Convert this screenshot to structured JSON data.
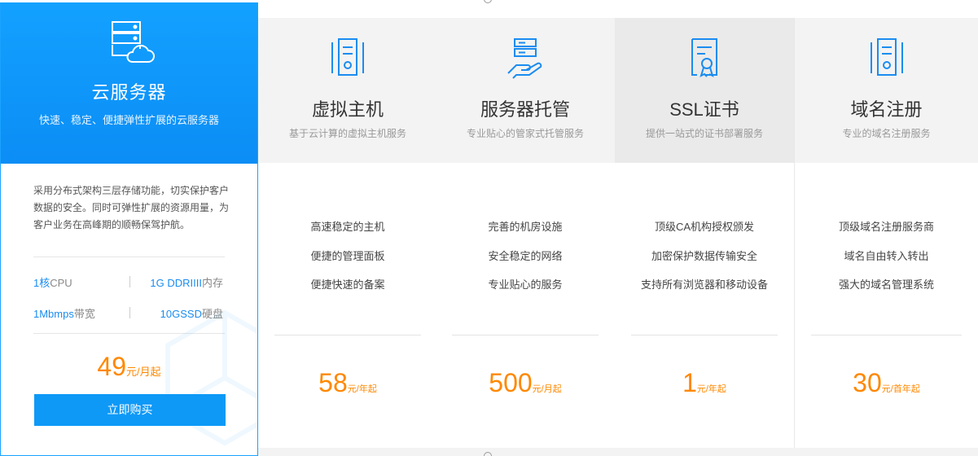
{
  "featured": {
    "title": "云服务器",
    "subtitle": "快速、稳定、便捷弹性扩展的云服务器",
    "description": "采用分布式架构三层存储功能，切实保护客户数据的安全。同时可弹性扩展的资源用量，为客户业务在高峰期的顺畅保驾护航。",
    "specs": [
      {
        "value": "1核",
        "unit": "CPU"
      },
      {
        "value": "1G DDRIIII",
        "unit": "内存"
      },
      {
        "value": "1Mbmps",
        "unit": "带宽"
      },
      {
        "value": "10GSSD",
        "unit": "硬盘"
      }
    ],
    "price": "49",
    "price_unit": "元/月起",
    "buy_label": "立即购买",
    "icon": "cloud-server-icon",
    "accent": "#0e99f7"
  },
  "products": [
    {
      "title": "虚拟主机",
      "subtitle": "基于云计算的虚拟主机服务",
      "features": [
        "高速稳定的主机",
        "便捷的管理面板",
        "便捷快速的备案"
      ],
      "price": "58",
      "price_unit": "元/年起",
      "icon": "server-tower-icon"
    },
    {
      "title": "服务器托管",
      "subtitle": "专业贴心的管家式托管服务",
      "features": [
        "完善的机房设施",
        "安全稳定的网络",
        "专业贴心的服务"
      ],
      "price": "500",
      "price_unit": "元/月起",
      "icon": "hand-server-icon"
    },
    {
      "title": "SSL证书",
      "subtitle": "提供一站式的证书部署服务",
      "features": [
        "顶级CA机构授权颁发",
        "加密保护数据传输安全",
        "支持所有浏览器和移动设备"
      ],
      "price": "1",
      "price_unit": "元/年起",
      "icon": "certificate-icon"
    },
    {
      "title": "域名注册",
      "subtitle": "专业的域名注册服务",
      "features": [
        "顶级域名注册服务商",
        "域名自由转入转出",
        "强大的域名管理系统"
      ],
      "price": "30",
      "price_unit": "元/首年起",
      "icon": "server-tower-icon"
    }
  ],
  "colors": {
    "price": "#ff8800",
    "icon_blue": "#1a8cf0",
    "header_bg": "#f3f3f3"
  }
}
